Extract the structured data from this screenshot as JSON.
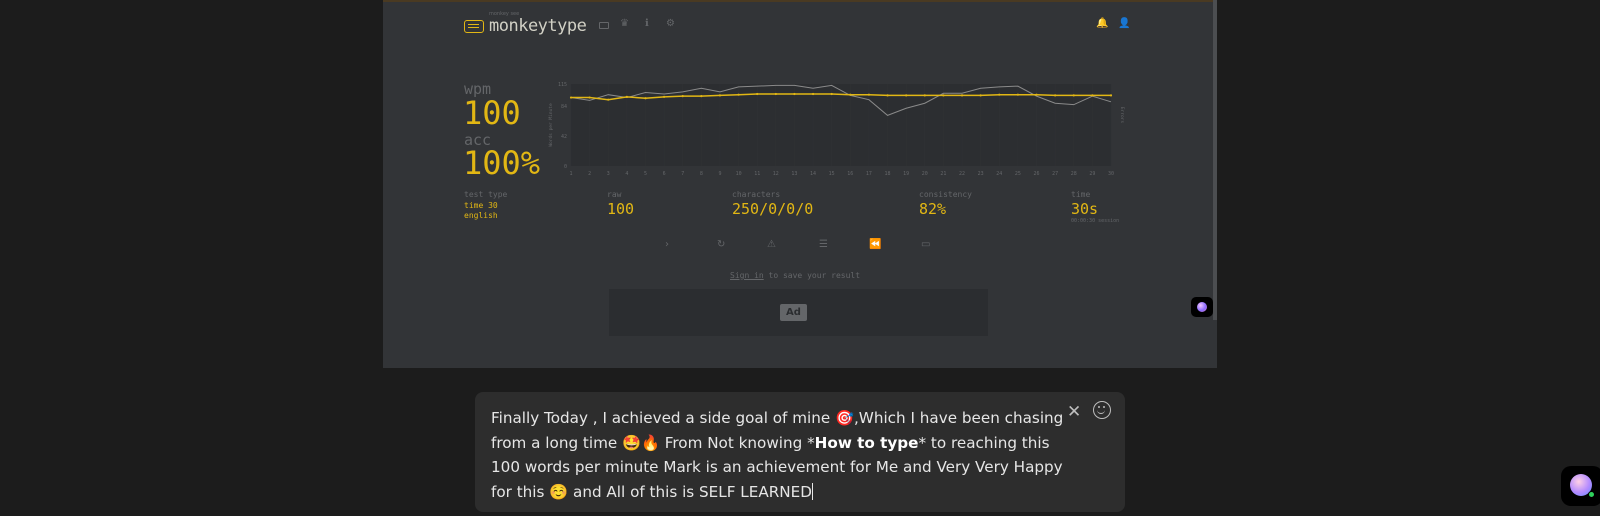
{
  "app": {
    "logo_small": "monkey see",
    "logo_text": "monkeytype",
    "nav_icons": [
      "keyboard-icon",
      "crown-icon",
      "info-icon",
      "gear-icon",
      "bell-icon",
      "user-icon"
    ]
  },
  "result": {
    "wpm_label": "wpm",
    "wpm_value": "100",
    "acc_label": "acc",
    "acc_value": "100%",
    "test_type_label": "test type",
    "test_type_mode": "time 30",
    "test_type_language": "english",
    "raw_label": "raw",
    "raw_value": "100",
    "characters_label": "characters",
    "characters_value": "250/0/0/0",
    "consistency_label": "consistency",
    "consistency_value": "82%",
    "time_label": "time",
    "time_value": "30s",
    "session_note": "00:00:30 session"
  },
  "actions": [
    "next-test-icon",
    "restart-icon",
    "report-icon",
    "word-history-icon",
    "replay-icon",
    "screenshot-icon"
  ],
  "signin": {
    "link": "Sign in",
    "rest": " to save your result"
  },
  "ad": {
    "label": "Ad"
  },
  "caption": {
    "line1_a": "Finally Today , I achieved a side goal of mine ",
    "emoji_target": "🎯",
    "line1_b": ",Which I have been chasing",
    "line2_a": "from a long time ",
    "emoji_starstruck": "🤩",
    "emoji_fire": "🔥",
    "line2_b": " From Not knowing *",
    "line2_bold": "How to type",
    "line2_c": "* to reaching this",
    "line3": "100 words per minute Mark is an achievement for Me and Very Very Happy",
    "line4_a": "for this ",
    "emoji_smile": "☺️",
    "line4_b": " and All of this is SELF LEARNED",
    "close_icon": "close-icon",
    "emoji_picker_icon": "emoji-icon"
  },
  "colors": {
    "accent": "#e2b714",
    "bg": "#323437",
    "sub": "#646669",
    "text": "#d1d0c5"
  },
  "chart_data": {
    "type": "line",
    "title": "",
    "xlabel": "",
    "ylabel": "Words per Minute",
    "y2label": "Errors",
    "x": [
      1,
      2,
      3,
      4,
      5,
      6,
      7,
      8,
      9,
      10,
      11,
      12,
      13,
      14,
      15,
      16,
      17,
      18,
      19,
      20,
      21,
      22,
      23,
      24,
      25,
      26,
      27,
      28,
      29,
      30
    ],
    "ylim": [
      0,
      115
    ],
    "yticks": [
      0,
      42,
      84,
      115
    ],
    "series": [
      {
        "name": "wpm",
        "color": "#e2b714",
        "values": [
          96,
          96,
          93,
          97,
          95,
          97,
          98,
          98,
          99,
          100,
          101,
          101,
          101,
          101,
          101,
          100,
          100,
          99,
          99,
          99,
          99,
          99,
          99,
          100,
          100,
          100,
          99,
          99,
          99,
          99
        ]
      },
      {
        "name": "raw",
        "color": "#8a8a8a",
        "values": [
          96,
          92,
          100,
          96,
          103,
          101,
          104,
          109,
          104,
          111,
          112,
          113,
          113,
          109,
          113,
          99,
          93,
          71,
          81,
          88,
          102,
          102,
          109,
          111,
          112,
          98,
          88,
          86,
          98,
          90
        ]
      }
    ]
  }
}
